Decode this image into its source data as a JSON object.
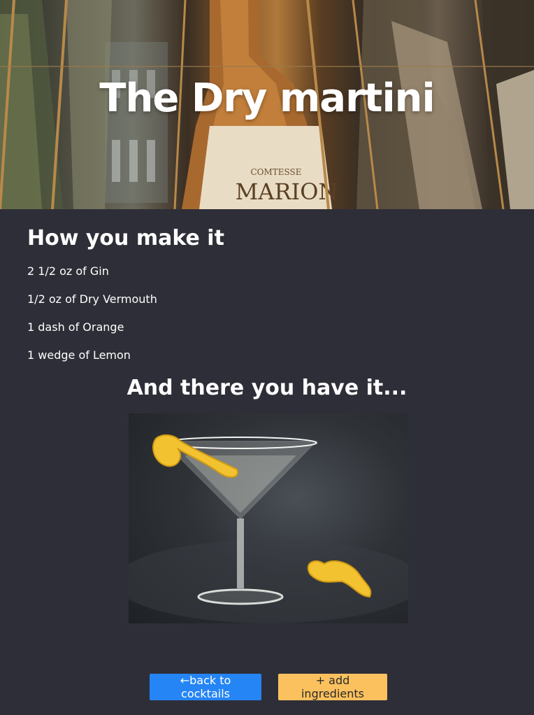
{
  "hero": {
    "title": "The Dry martini",
    "bottle_label_brand": "COMTESSE",
    "bottle_label_name": "MARION"
  },
  "recipe": {
    "heading": "How you make it",
    "ingredients": [
      "2 1/2 oz of Gin",
      "1/2 oz of Dry Vermouth",
      "1 dash of Orange",
      "1 wedge of Lemon"
    ]
  },
  "result": {
    "heading": "And there you have it..."
  },
  "actions": {
    "back_label": "←back to cocktails",
    "add_label": "+ add ingredients"
  },
  "colors": {
    "background": "#2e2e38",
    "back_button": "#2585f4",
    "add_button": "#fbc15e"
  }
}
